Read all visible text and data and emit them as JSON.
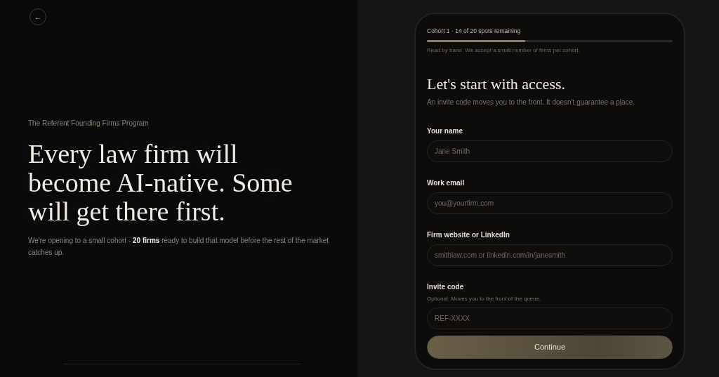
{
  "back_button": {
    "label": "←"
  },
  "hero": {
    "eyebrow": "The Referent Founding Firms Program",
    "headline": "Every law firm will become AI-native. Some will get there first.",
    "body": "We're opening to a small cohort - **20 firms** ready to build that model before the rest of the market catches up."
  },
  "form": {
    "cohort_status": "Cohort 1 · 14 of 20 spots remaining",
    "progress": {
      "level": 0.4
    },
    "note": "Read by hand. We accept a small number of firms per cohort.",
    "title": "Let's start with access.",
    "subtitle": "An invite code moves you to the front. It doesn't guarantee a place.",
    "fields": [
      {
        "label": "Your name",
        "placeholder": "Jane Smith"
      },
      {
        "label": "Work email",
        "placeholder": "you@yourfirm.com"
      },
      {
        "label": "Firm website or LinkedIn",
        "placeholder": "smithlaw.com or linkedin.com/in/janesmith"
      },
      {
        "label": "Invite code",
        "hint": "Optional. Moves you to the front of the queue.",
        "placeholder": "REF-XXXX"
      }
    ],
    "submit": "Continue"
  }
}
